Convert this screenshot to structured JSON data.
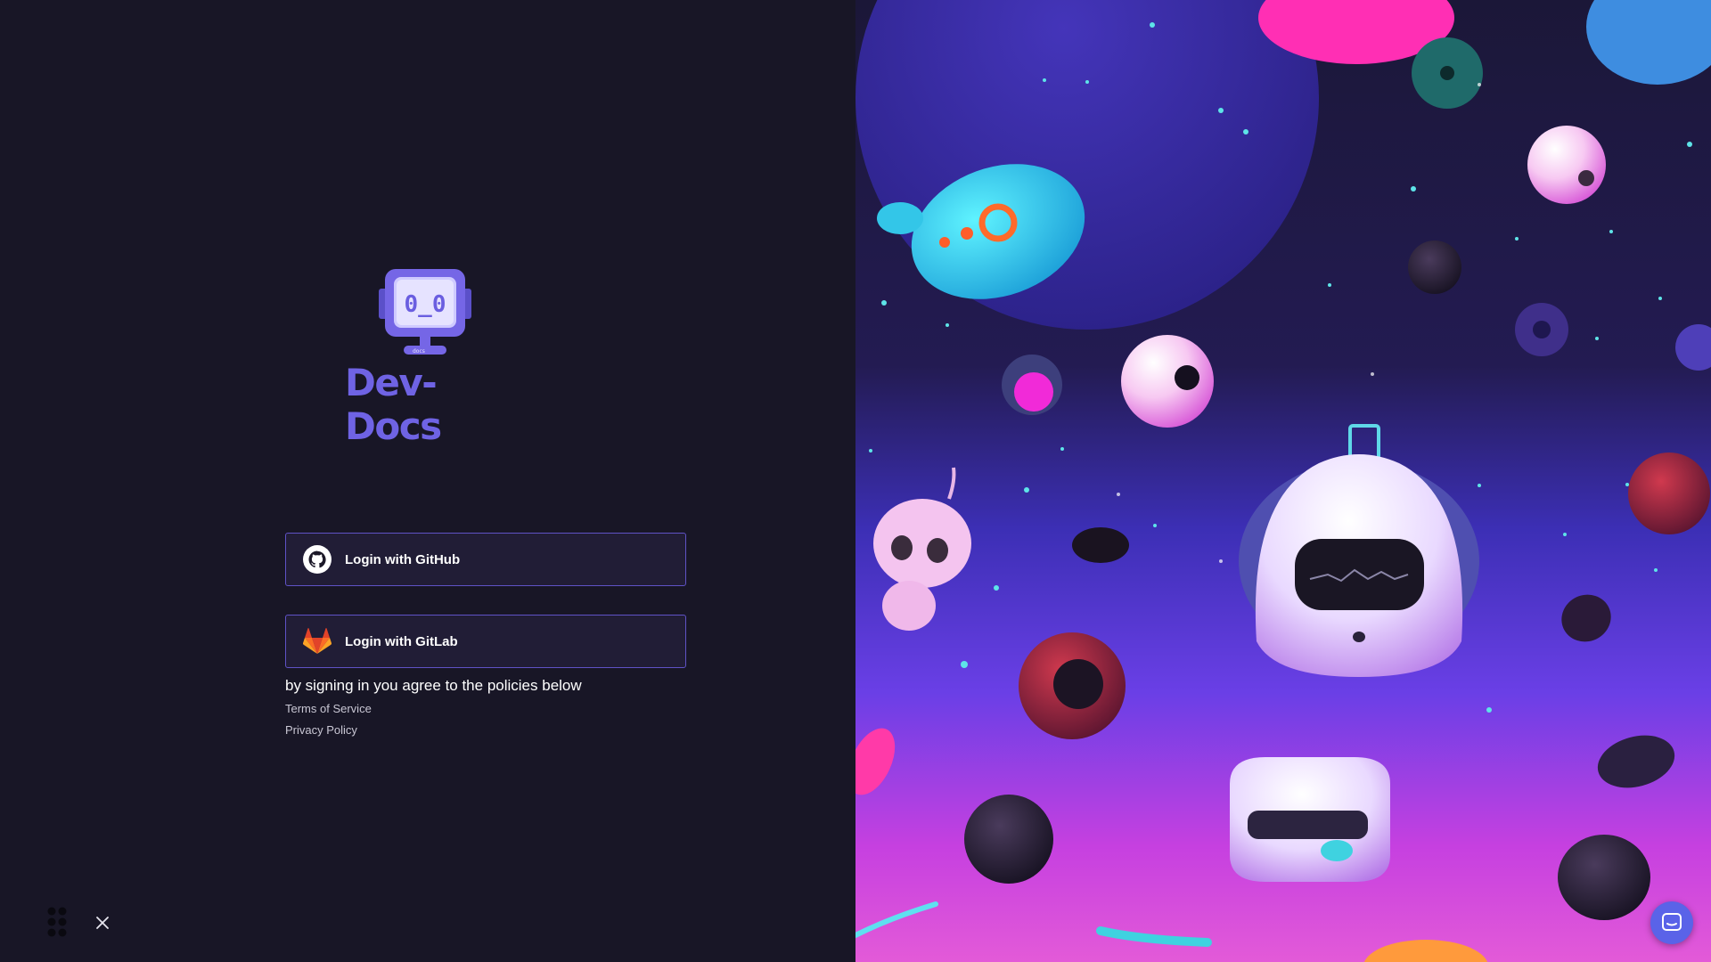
{
  "brand": {
    "name": "Dev-Docs",
    "mascot_face": "0_0",
    "mascot_label": "docs",
    "color": "#6f63e4"
  },
  "login": {
    "github_label": "Login with GitHub",
    "gitlab_label": "Login with GitLab"
  },
  "policies": {
    "agreement_text": "by signing in you agree to the policies below",
    "terms_label": "Terms of Service",
    "privacy_label": "Privacy Policy"
  },
  "icons": {
    "apps": "grid-dots-icon",
    "close": "close-icon",
    "chat": "chat-bubble-icon",
    "github": "github-icon",
    "gitlab": "gitlab-icon"
  },
  "colors": {
    "background": "#181626",
    "button_bg": "#211d36",
    "button_border": "#5f52c6",
    "accent": "#5a63e8"
  }
}
